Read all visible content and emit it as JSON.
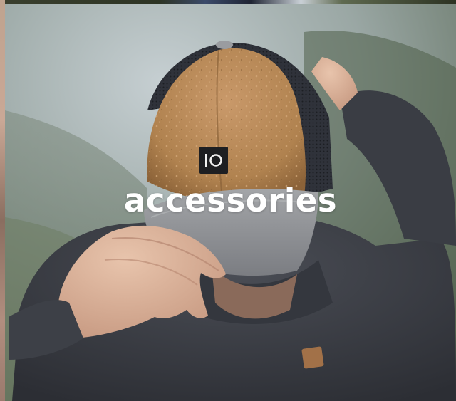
{
  "hero": {
    "title": "accessories"
  },
  "icons": {
    "cap_patch": "tentree-logo-icon"
  },
  "colors": {
    "title": "#ffffff",
    "cork": "#b98a5c",
    "brim": "#8d8f94",
    "sweater": "#3b3e45"
  }
}
